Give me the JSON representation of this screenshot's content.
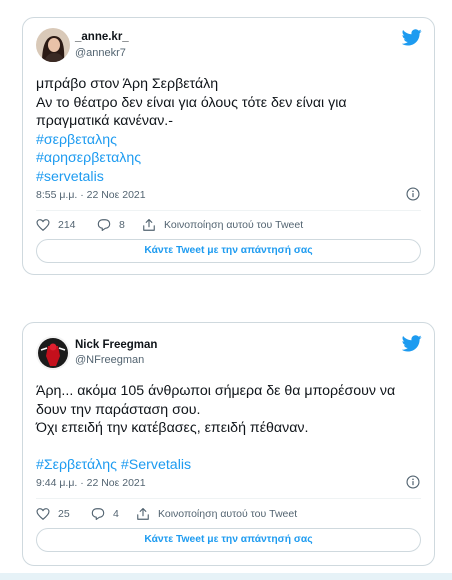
{
  "tweets": [
    {
      "display_name": "_anne.kr_",
      "handle": "@annekr7",
      "lines": [
        {
          "text": "μπράβο στον Άρη Σερβετάλη",
          "hashtag": false
        },
        {
          "text": "Αν το θέατρο δεν είναι για όλους τότε δεν είναι για",
          "hashtag": false
        },
        {
          "text": "πραγματικά κανέναν.-",
          "hashtag": false
        },
        {
          "text": "#σερβεταλης",
          "hashtag": true
        },
        {
          "text": "#αρησερβεταλης",
          "hashtag": true
        },
        {
          "text": "#servetalis",
          "hashtag": true
        }
      ],
      "timestamp": "8:55 μ.μ. · 22 Νοε 2021",
      "likes": "214",
      "replies": "8",
      "share_label": "Κοινοποίηση αυτού του Tweet",
      "reply_button": "Κάντε Tweet με την απάντησή σας"
    },
    {
      "display_name": "Nick Freegman",
      "handle": "@NFreegman",
      "lines": [
        {
          "text": "Άρη... ακόμα 105 άνθρωποι σήμερα δε θα μπορέσουν να",
          "hashtag": false
        },
        {
          "text": "δουν την παράσταση σου.",
          "hashtag": false
        },
        {
          "text": "Όχι επειδή την κατέβασες, επειδή πέθαναν.",
          "hashtag": false
        },
        {
          "text": "",
          "hashtag": false
        },
        {
          "text": "#Σερβετάλης #Servetalis",
          "hashtag": true
        }
      ],
      "timestamp": "9:44 μ.μ. · 22 Νοε 2021",
      "likes": "25",
      "replies": "4",
      "share_label": "Κοινοποίηση αυτού του Tweet",
      "reply_button": "Κάντε Tweet με την απάντησή σας"
    }
  ],
  "colors": {
    "accent": "#1d9bf0",
    "text": "#0f1419",
    "muted": "#536471",
    "border": "#cfd9de"
  },
  "icons": {
    "brand": "twitter-bird-icon",
    "info": "info-icon",
    "like": "heart-icon",
    "reply": "reply-bubble-icon",
    "share": "share-icon"
  }
}
